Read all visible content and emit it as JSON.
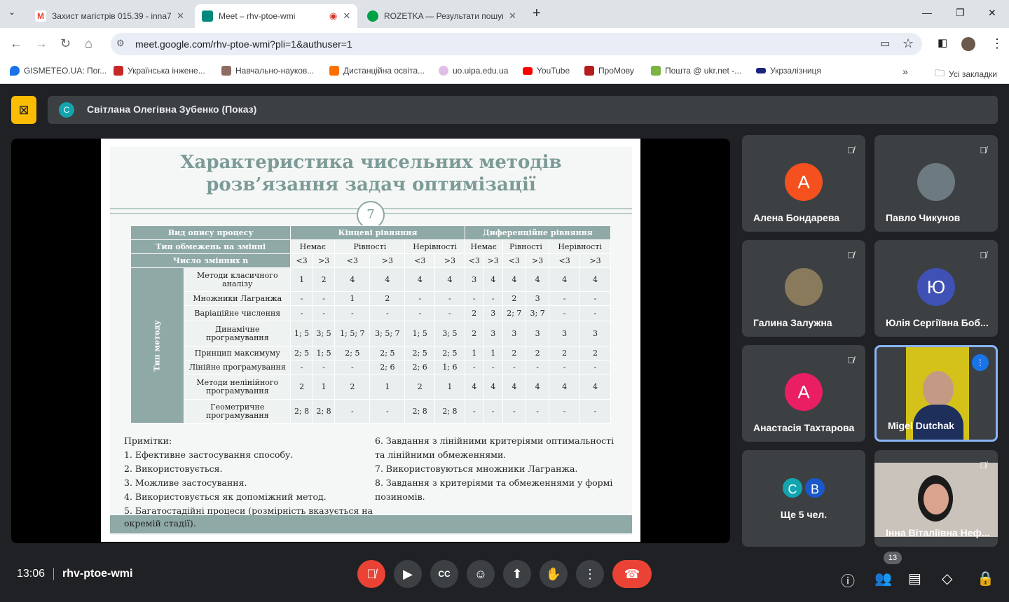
{
  "browser": {
    "tabs": [
      {
        "title": "Захист магістрів 015.39 - inna7",
        "icon": "gmail-icon"
      },
      {
        "title": "Meet – rhv-ptoe-wmi",
        "icon": "meet-icon"
      },
      {
        "title": "ROZETKA — Результати пошуку",
        "icon": "rozetka-icon"
      }
    ],
    "url": "meet.google.com/rhv-ptoe-wmi?pli=1&authuser=1",
    "bookmarks": [
      "GISMETEO.UA: Пог...",
      "Українська інжене...",
      "Навчально-науков...",
      "Дистанційна освіта...",
      "uo.uipa.edu.ua",
      "YouTube",
      "ПроМову",
      "Пошта @ ukr.net -...",
      "Укрзалізниця"
    ],
    "all_bookmarks": "Усі закладки"
  },
  "meet": {
    "presenter_initial": "С",
    "presenter": "Світлана Олегівна Зубенко (Показ)",
    "time": "13:06",
    "code": "rhv-ptoe-wmi",
    "participants_count": "13"
  },
  "slide": {
    "title_line1": "Характеристика чисельних методів",
    "title_line2": "розв’язання задач оптимізації",
    "number": "7",
    "hdr_process": "Вид опису процесу",
    "hdr_finite": "Кінцеві рівняння",
    "hdr_diff": "Диференційне рівняння",
    "hdr_constraints": "Тип обмежень на змінні",
    "constraint_types": [
      "Немає",
      "Рівності",
      "Нерівності",
      "Немає",
      "Рівності",
      "Нерівності"
    ],
    "hdr_vars": "Число змінних n",
    "var_cols": [
      "<3",
      ">3",
      "<3",
      ">3",
      "<3",
      ">3",
      "<3",
      ">3",
      "<3",
      ">3",
      "<3",
      ">3"
    ],
    "method_type": "Тип методу",
    "rows": [
      {
        "name": "Методи класичного аналізу",
        "v": [
          "1",
          "2",
          "4",
          "4",
          "4",
          "4",
          "3",
          "4",
          "4",
          "4",
          "4",
          "4"
        ]
      },
      {
        "name": "Множники Лагранжа",
        "v": [
          "-",
          "-",
          "1",
          "2",
          "-",
          "-",
          "-",
          "-",
          "2",
          "3",
          "-",
          "-"
        ]
      },
      {
        "name": "Варіаційне числення",
        "v": [
          "-",
          "-",
          "-",
          "-",
          "-",
          "-",
          "2",
          "3",
          "2; 7",
          "3; 7",
          "-",
          "-"
        ]
      },
      {
        "name": "Динамічне програмування",
        "v": [
          "1; 5",
          "3; 5",
          "1; 5; 7",
          "3; 5; 7",
          "1; 5",
          "3; 5",
          "2",
          "3",
          "3",
          "3",
          "3",
          "3"
        ]
      },
      {
        "name": "Принцип максимуму",
        "v": [
          "2; 5",
          "1; 5",
          "2; 5",
          "2; 5",
          "2; 5",
          "2; 5",
          "1",
          "1",
          "2",
          "2",
          "2",
          "2"
        ]
      },
      {
        "name": "Лінійне програмування",
        "v": [
          "-",
          "-",
          "-",
          "2; 6",
          "2; 6",
          "1; 6",
          "-",
          "-",
          "-",
          "-",
          "-",
          "-"
        ]
      },
      {
        "name": "Методи нелінійного програмування",
        "v": [
          "2",
          "1",
          "2",
          "1",
          "2",
          "1",
          "4",
          "4",
          "4",
          "4",
          "4",
          "4"
        ]
      },
      {
        "name": "Геометричне програмування",
        "v": [
          "2; 8",
          "2; 8",
          "-",
          "-",
          "2; 8",
          "2; 8",
          "-",
          "-",
          "-",
          "-",
          "-",
          "-"
        ]
      }
    ],
    "notes_left": [
      "Примітки:",
      "1. Ефективне застосування способу.",
      "2. Використовується.",
      "3. Можливе застосування.",
      "4. Використовується як допоміжний метод.",
      "5. Багатостадійні процеси (розмірність вказується на",
      "окремій стадії)."
    ],
    "notes_right": [
      "6. Завдання з лінійними критеріями оптимальності",
      "та лінійними обмеженнями.",
      "7. Використовуються множники Лагранжа.",
      "8. Завдання з критеріями та обмеженнями у формі",
      "позиномів."
    ]
  },
  "participants": [
    {
      "name": "Алена Бондарева",
      "initial": "А",
      "color": "#f4511e"
    },
    {
      "name": "Павло Чикунов",
      "initial": "",
      "color": "#6d7a82"
    },
    {
      "name": "Галина Залужна",
      "initial": "",
      "color": "#8a7a5c"
    },
    {
      "name": "Юлія Сергіївна Боб...",
      "initial": "Ю",
      "color": "#3f51b5"
    },
    {
      "name": "Анастасія Тахтарова",
      "initial": "А",
      "color": "#e91e63"
    },
    {
      "name": "Migel Dutchak",
      "initial": "",
      "color": "#d4c21a"
    },
    {
      "name": "Ще 5 чел.",
      "initial": "",
      "color": "#3c4043"
    },
    {
      "name": "Інна Віталіївна Неф...",
      "initial": "",
      "color": "#c9c3bb"
    }
  ],
  "more_avatars": [
    "С",
    "В"
  ]
}
